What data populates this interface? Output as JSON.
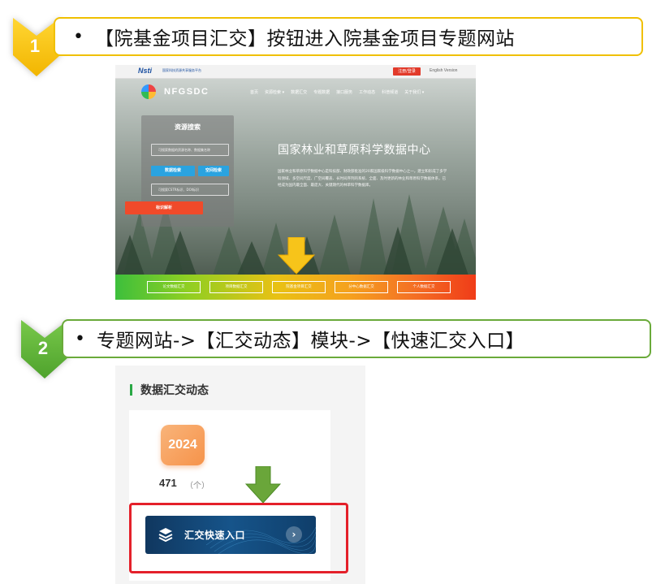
{
  "step1": {
    "number": "1",
    "bullet": "•",
    "text": "【院基金项目汇交】按钮进入院基金项目专题网站",
    "chevron_color": "#f8c000",
    "border_color": "#f0c000"
  },
  "step2": {
    "number": "2",
    "bullet": "•",
    "text": "专题网站->【汇交动态】模块->【快速汇交入口】",
    "chevron_color": "#5cb334",
    "border_color": "#6aaa3a"
  },
  "site": {
    "logo": "Nsti",
    "logo_subtitle": "国家科技资源共享服务平台",
    "login_label": "注册/登录",
    "english_label": "English Version",
    "brand": "NFGSDC",
    "nav": [
      "首页",
      "资源检索 ▾",
      "数据汇交",
      "专题数据",
      "接口服务",
      "工作动态",
      "科普频道",
      "关于我们 ▾"
    ],
    "search": {
      "title": "资源搜索",
      "input1_placeholder": "可搜索数据的资源名称、数据集名称",
      "data_search": "数据检索",
      "space_search": "空间检索",
      "input2_placeholder": "可搜索CSTR标识、DOI标识",
      "resolve": "标识解析"
    },
    "hero_title": "国家林业和草原科学数据中心",
    "hero_desc": "国家林业和草原科学数据中心是科技部、财政部批准的20家国家级科学数据中心之一，建立和形成了多学科领域、多空间尺度、广空间覆盖、长时间序列的系统、全面、及时更新的林业和草原科学数据体系，已经成为国内最全面、最庞大、关键期代的林草科学数据库。",
    "bottom_buttons": [
      "论文数据汇交",
      "项目数据汇交",
      "院基金项目汇交",
      "分中心数据汇交",
      "个人数据汇交"
    ]
  },
  "module": {
    "title": "数据汇交动态",
    "year": "2024",
    "count": "471",
    "unit": "（个）",
    "quick_entry": "汇交快速入口",
    "accent": "#2aa845",
    "frame_color": "#e4202a"
  }
}
